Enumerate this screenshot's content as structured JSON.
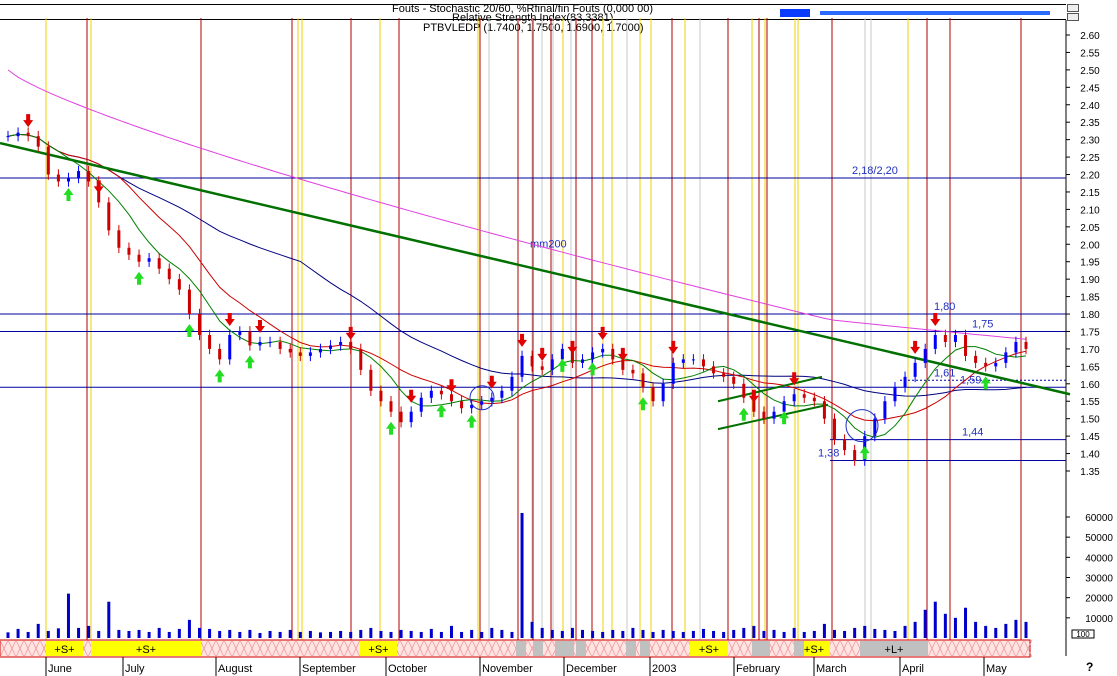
{
  "header": {
    "line1": "Fouts - Stochastic 20/60, %Rfinal/fin Fouts (0,000 00)",
    "line2": "Relative Strength Index(83,3381)",
    "line3": "PTBVLEDP (1.7400, 1.7500, 1.6900, 1.7000)"
  },
  "chart_data": {
    "type": "candlestick",
    "title": "PTBVLEDP (1.7400, 1.7500, 1.6900, 1.7000)",
    "ohlc_last": {
      "open": 1.74,
      "high": 1.75,
      "low": 1.69,
      "close": 1.7
    },
    "price_axis": {
      "min": 1.35,
      "max": 2.6,
      "step": 0.05,
      "labels": [
        "2.60",
        "2.55",
        "2.50",
        "2.45",
        "2.40",
        "2.35",
        "2.30",
        "2.25",
        "2.20",
        "2.15",
        "2.10",
        "2.05",
        "2.00",
        "1.95",
        "1.90",
        "1.85",
        "1.80",
        "1.75",
        "1.70",
        "1.65",
        "1.60",
        "1.55",
        "1.50",
        "1.45",
        "1.40",
        "1.35"
      ]
    },
    "volume_axis": {
      "min": 0,
      "max": 60000,
      "labels": [
        "60000",
        "50000",
        "40000",
        "30000",
        "20000",
        "10000"
      ],
      "unit_label": "100"
    },
    "months": [
      "June",
      "July",
      "August",
      "September",
      "October",
      "November",
      "December",
      "2003",
      "February",
      "March",
      "April",
      "May"
    ],
    "close_series": [
      2.31,
      2.32,
      2.31,
      2.28,
      2.2,
      2.18,
      2.19,
      2.21,
      2.18,
      2.12,
      2.04,
      1.99,
      1.97,
      1.95,
      1.96,
      1.93,
      1.9,
      1.87,
      1.8,
      1.74,
      1.7,
      1.67,
      1.74,
      1.75,
      1.71,
      1.72,
      1.72,
      1.7,
      1.69,
      1.68,
      1.69,
      1.7,
      1.71,
      1.72,
      1.7,
      1.64,
      1.58,
      1.55,
      1.52,
      1.49,
      1.52,
      1.56,
      1.58,
      1.57,
      1.55,
      1.53,
      1.54,
      1.55,
      1.56,
      1.58,
      1.62,
      1.68,
      1.65,
      1.64,
      1.67,
      1.7,
      1.66,
      1.67,
      1.69,
      1.7,
      1.67,
      1.64,
      1.63,
      1.59,
      1.55,
      1.6,
      1.66,
      1.67,
      1.67,
      1.65,
      1.63,
      1.62,
      1.6,
      1.56,
      1.52,
      1.5,
      1.52,
      1.55,
      1.57,
      1.56,
      1.55,
      1.5,
      1.44,
      1.41,
      1.38,
      1.45,
      1.5,
      1.55,
      1.59,
      1.62,
      1.66,
      1.7,
      1.74,
      1.72,
      1.74,
      1.68,
      1.66,
      1.65,
      1.66,
      1.69,
      1.72,
      1.7
    ],
    "volume_series": [
      2800,
      4500,
      3000,
      7000,
      3500,
      4800,
      22000,
      5000,
      6000,
      3500,
      18000,
      4000,
      3500,
      4000,
      3000,
      5000,
      3000,
      4500,
      9000,
      5000,
      4500,
      3500,
      4000,
      3000,
      4000,
      2500,
      3500,
      3000,
      4000,
      3000,
      3500,
      2800,
      3000,
      3500,
      3000,
      4000,
      5000,
      3500,
      3000,
      4000,
      3500,
      3000,
      4500,
      3000,
      6000,
      3000,
      4000,
      3000,
      5000,
      4000,
      3000,
      62000,
      8000,
      5000,
      4000,
      3500,
      5000,
      4000,
      3500,
      3000,
      4000,
      3500,
      5000,
      4000,
      3000,
      4000,
      3500,
      3000,
      3500,
      4500,
      3500,
      3000,
      4000,
      5000,
      6000,
      3500,
      4000,
      3000,
      5000,
      3000,
      3500,
      7000,
      4000,
      3500,
      5000,
      6000,
      4500,
      4000,
      3500,
      6000,
      8000,
      14000,
      18000,
      12000,
      10000,
      15000,
      8000,
      6000,
      5000,
      7000,
      9000,
      8000
    ],
    "indicators": [
      {
        "name": "mm200",
        "color": "#e040e0"
      },
      {
        "name": "",
        "color": "#000080"
      },
      {
        "name": "",
        "color": "#cc0000"
      },
      {
        "name": "",
        "color": "#008000"
      }
    ],
    "annotations": [
      {
        "text": "2,18/2,20",
        "price": 2.19
      },
      {
        "text": "mm200",
        "price": 1.98
      },
      {
        "text": "1,80",
        "price": 1.8
      },
      {
        "text": "1,75",
        "price": 1.75
      },
      {
        "text": "1,61",
        "price": 1.61
      },
      {
        "text": "1,59",
        "price": 1.59
      },
      {
        "text": "1,44",
        "price": 1.44
      },
      {
        "text": "1,38",
        "price": 1.38
      }
    ],
    "horizontal_levels": [
      2.19,
      1.8,
      1.75,
      1.59,
      1.44,
      1.38
    ],
    "signal_labels": [
      "+S+",
      "+S+",
      "+S+",
      "+S+",
      "+S+",
      "+L+"
    ],
    "grid": false,
    "legend": "none"
  },
  "footer": {
    "help_glyph": "?"
  }
}
